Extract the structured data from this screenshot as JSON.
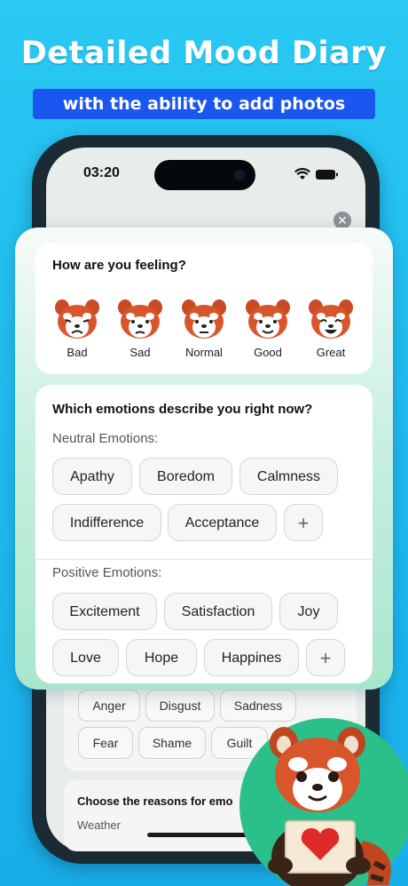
{
  "promo": {
    "headline": "Detailed Mood Diary",
    "subline": "with the ability to add photos"
  },
  "status_bar": {
    "time": "03:20"
  },
  "mood_card": {
    "question": "How are you feeling?",
    "moods": [
      "Bad",
      "Sad",
      "Normal",
      "Good",
      "Great"
    ]
  },
  "emotions_card": {
    "question": "Which emotions describe you right now?",
    "neutral_label": "Neutral Emotions:",
    "neutral": [
      "Apathy",
      "Boredom",
      "Calmness",
      "Indifference",
      "Acceptance"
    ],
    "positive_label": "Positive Emotions:",
    "positive": [
      "Excitement",
      "Satisfaction",
      "Joy",
      "Love",
      "Hope",
      "Happines"
    ],
    "add_symbol": "+"
  },
  "negative_chips": [
    "Anger",
    "Disgust",
    "Sadness",
    "Fear",
    "Shame",
    "Guilt"
  ],
  "reasons_card": {
    "title": "Choose the reasons for emo",
    "first_item": "Weather"
  },
  "colors": {
    "background": "#1fb8ee",
    "subline_bar": "#1a56f0",
    "panda_orange": "#d9552b",
    "heart": "#e02a2a"
  }
}
